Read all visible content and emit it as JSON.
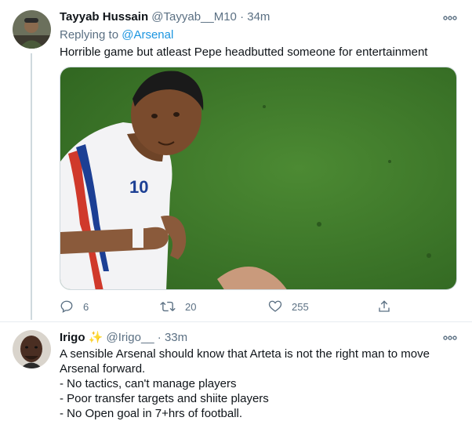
{
  "tweet1": {
    "name": "Tayyab Hussain",
    "handle": "@Tayyab__M10",
    "separator": "·",
    "time": "34m",
    "replying_prefix": "Replying to ",
    "replying_to": "@Arsenal",
    "text": "Horrible game but atleast Pepe headbutted someone for entertainment",
    "actions": {
      "reply_count": "6",
      "retweet_count": "20",
      "like_count": "255"
    },
    "media_jersey_number": "10"
  },
  "tweet2": {
    "name": "Irigo",
    "name_emoji": "✨",
    "handle": "@Irigo__",
    "separator": "·",
    "time": "33m",
    "lines": [
      "A sensible Arsenal should know that Arteta is not the right man to move",
      "Arsenal forward.",
      "- No tactics, can't manage players",
      "- Poor transfer targets and shiite players",
      "- No Open goal in 7+hrs of football."
    ]
  },
  "colors": {
    "link": "#1b95e0",
    "secondary_text": "#5b7083",
    "divider": "#e6ecf0",
    "pitch": "#3f7a2a"
  },
  "icons": [
    "more-icon",
    "reply-icon",
    "retweet-icon",
    "like-icon",
    "share-icon",
    "sparkles-icon"
  ]
}
